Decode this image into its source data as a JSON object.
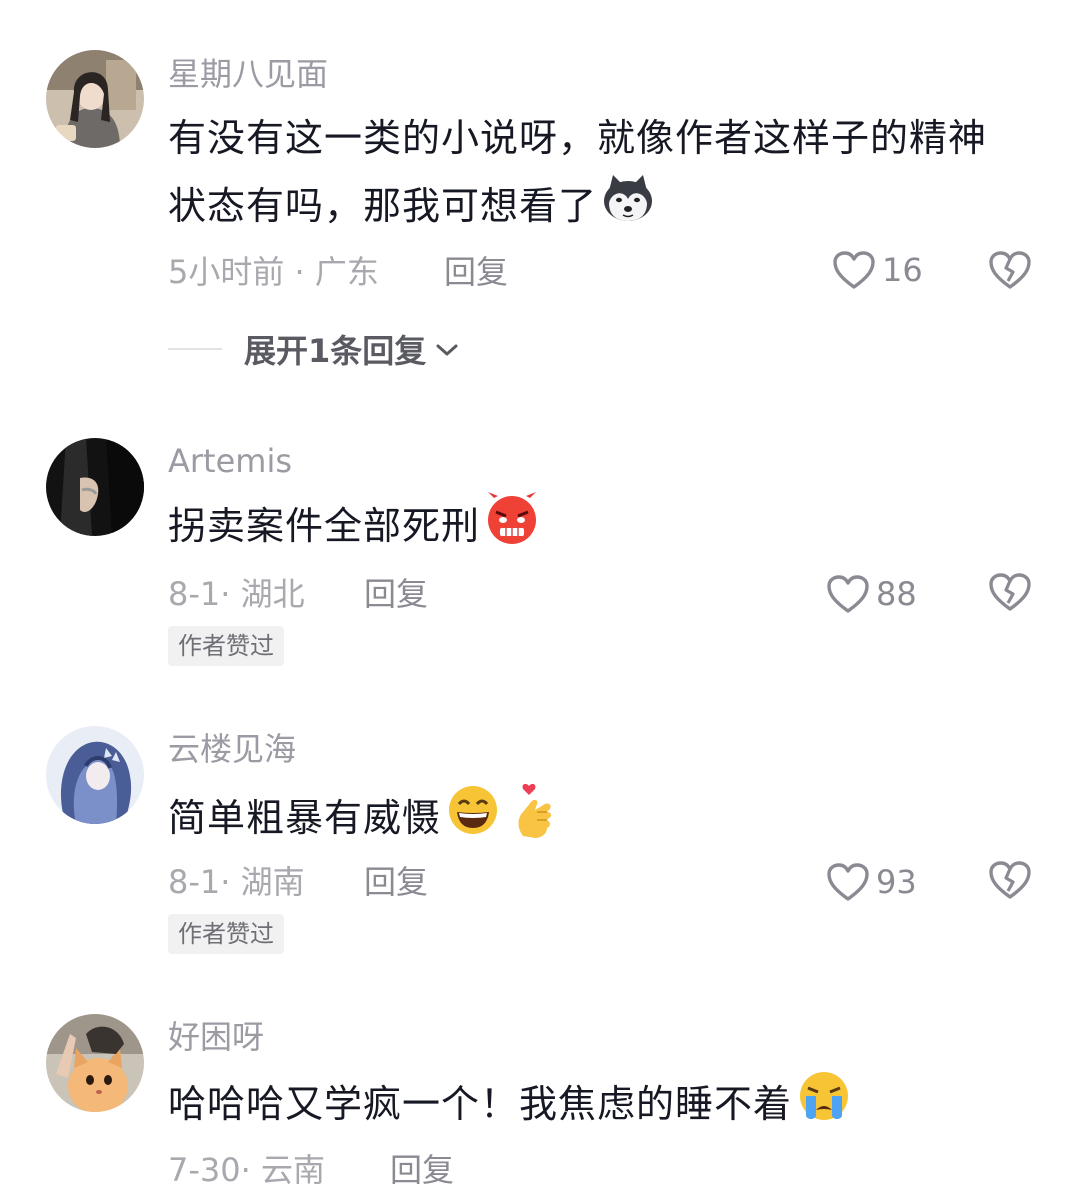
{
  "comments": [
    {
      "username": "星期八见面",
      "text_lines": [
        "有没有这一类的小说呀，就像作者这样子的精神",
        "状态有吗，那我可想看了"
      ],
      "emoji": "husky-emoji",
      "meta": "5小时前 · 广东",
      "reply_label": "回复",
      "likes": "16",
      "expand_label": "展开1条回复"
    },
    {
      "username": "Artemis",
      "text": "拐卖案件全部死刑",
      "emoji": "angry-face-emoji",
      "meta": "8-1· 湖北",
      "reply_label": "回复",
      "likes": "88",
      "badge": "作者赞过"
    },
    {
      "username": "云楼见海",
      "text": "简单粗暴有威慑",
      "emoji": "grin-emoji, finger-heart-emoji",
      "meta": "8-1· 湖南",
      "reply_label": "回复",
      "likes": "93",
      "badge": "作者赞过"
    },
    {
      "username": "好困呀",
      "text": "哈哈哈又学疯一个！我焦虑的睡不着",
      "emoji": "crying-face-emoji",
      "meta": "7-30· 云南",
      "reply_label": "回复"
    }
  ],
  "colors": {
    "text": "#161823",
    "muted": "#9b9ba3",
    "badge_bg": "#f1f1f2"
  }
}
